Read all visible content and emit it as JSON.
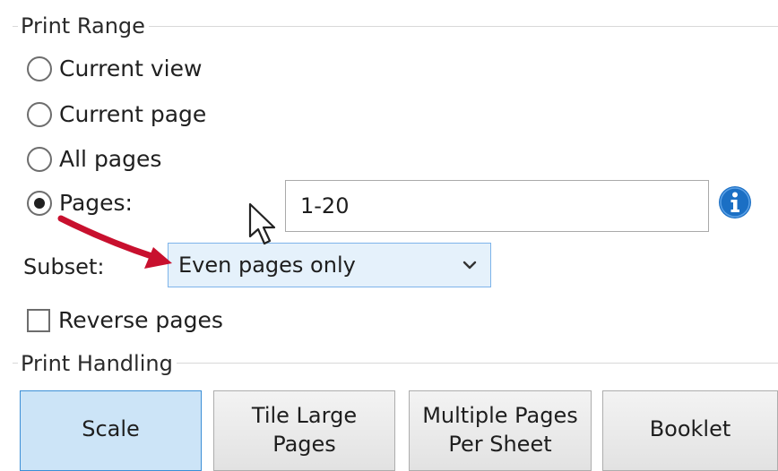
{
  "print_range": {
    "title": "Print Range",
    "options": [
      {
        "label": "Current view",
        "checked": false
      },
      {
        "label": "Current page",
        "checked": false
      },
      {
        "label": "All pages",
        "checked": false
      },
      {
        "label": "Pages:",
        "checked": true
      }
    ],
    "pages_input": {
      "value": "1-20"
    },
    "info_icon": "info-icon",
    "subset": {
      "label": "Subset:",
      "selected": "Even pages only"
    },
    "reverse_pages": {
      "label": "Reverse pages",
      "checked": false
    }
  },
  "print_handling": {
    "title": "Print Handling",
    "buttons": [
      {
        "label": "Scale",
        "active": true
      },
      {
        "label": "Tile Large\nPages",
        "active": false
      },
      {
        "label": "Multiple Pages\nPer Sheet",
        "active": false
      },
      {
        "label": "Booklet",
        "active": false
      }
    ]
  },
  "colors": {
    "accent_border": "#3c8fd6",
    "active_button": "#cce4f7",
    "select_background": "#e5f1fb",
    "info_icon": "#1b6fc4",
    "annotation_arrow": "#c8102e"
  },
  "annotations": {
    "arrow": "arrow-icon",
    "cursor": "mouse-cursor-icon"
  }
}
